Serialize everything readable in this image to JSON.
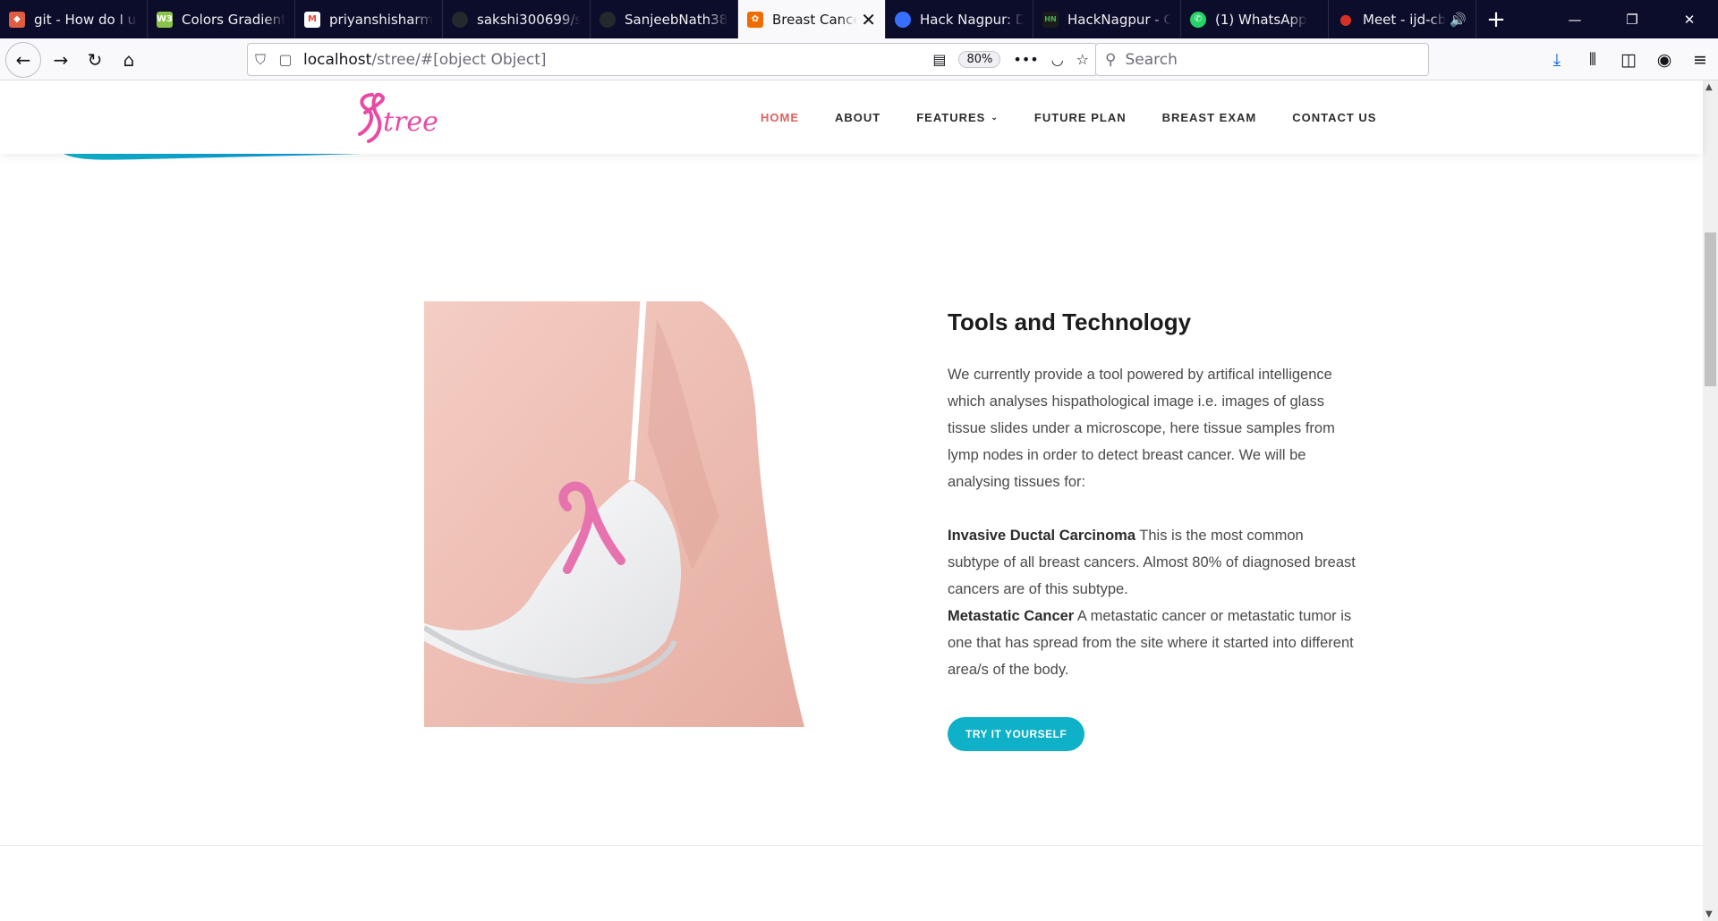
{
  "browser": {
    "tabs": [
      {
        "label": "git - How do I up",
        "icon": "git-icon",
        "color": "#e05d44"
      },
      {
        "label": "Colors Gradient",
        "icon": "gradient-icon",
        "color": "#8bc34a"
      },
      {
        "label": "priyanshisharma",
        "icon": "gmail-icon",
        "color": "#ea4335"
      },
      {
        "label": "sakshi300699/str",
        "icon": "github-icon",
        "color": "#24292e"
      },
      {
        "label": "SanjeebNath382",
        "icon": "github-icon",
        "color": "#24292e"
      },
      {
        "label": "Breast Cancer",
        "icon": "site-icon",
        "color": "#ef6c00",
        "active": true
      },
      {
        "label": "Hack Nagpur: Da",
        "icon": "devfolio-icon",
        "color": "#3770ff"
      },
      {
        "label": "HackNagpur - Ce",
        "icon": "hacknagpur-icon",
        "color": "#1b1b1b"
      },
      {
        "label": "(1) WhatsApp",
        "icon": "whatsapp-icon",
        "color": "#25d366"
      },
      {
        "label": "Meet - ijd-cb",
        "icon": "mic-icon",
        "color": "#d93025"
      }
    ],
    "url_host": "localhost",
    "url_path": "/stree/#[object Object]",
    "zoom": "80%",
    "search_placeholder": "Search"
  },
  "site": {
    "logo_text": "Stree",
    "logo_color": "#e84aa4",
    "nav": {
      "home": "HOME",
      "about": "ABOUT",
      "features": "FEATURES",
      "future_plan": "FUTURE PLAN",
      "breast_exam": "BREAST EXAM",
      "contact_us": "CONTACT US"
    },
    "accent_color": "#0eb1c7"
  },
  "section": {
    "title": "Tools and Technology",
    "intro": "We currently provide a tool powered by artifical intelligence which analyses hispathological image i.e. images of glass tissue slides under a microscope, here tissue samples from lymp nodes in order to detect breast cancer. We will be analysing tissues for:",
    "item1_title": "Invasive Ductal Carcinoma",
    "item1_text": " This is the most common subtype of all breast cancers. Almost 80% of diagnosed breast cancers are of this subtype.",
    "item2_title": "Metastatic Cancer",
    "item2_text": " A metastatic cancer or metastatic tumor is one that has spread from the site where it started into different area/s of the body.",
    "cta_label": "TRY IT YOURSELF"
  }
}
